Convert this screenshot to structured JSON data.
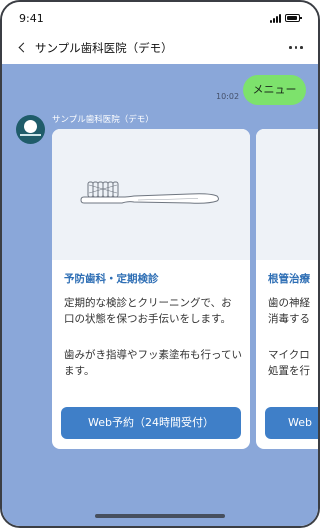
{
  "status_bar": {
    "time": "9:41"
  },
  "header": {
    "title": "サンプル歯科医院（デモ）"
  },
  "chat": {
    "user_message": {
      "text": "メニュー",
      "time": "10:02"
    },
    "bot": {
      "name": "サンプル歯科医院（デモ）",
      "avatar_caption": "サンプル歯科医院"
    },
    "cards": [
      {
        "title": "予防歯科・定期検診",
        "text1": "定期的な検診とクリーニングで、お口の状態を保つお手伝いをします。",
        "text2": "歯みがき指導やフッ素塗布も行っています。",
        "button": "Web予約（24時間受付）",
        "image_icon": "toothbrush-icon"
      },
      {
        "title": "根管治療",
        "text1": "歯の神経",
        "text1b": "消毒する",
        "text2": "マイクロ",
        "text2b": "処置を行",
        "button": "Web"
      }
    ]
  },
  "colors": {
    "chat_background": "#8aa7d9",
    "user_bubble": "#7de26c",
    "accent_blue": "#3f7fc8",
    "title_blue": "#2f6fb5"
  }
}
